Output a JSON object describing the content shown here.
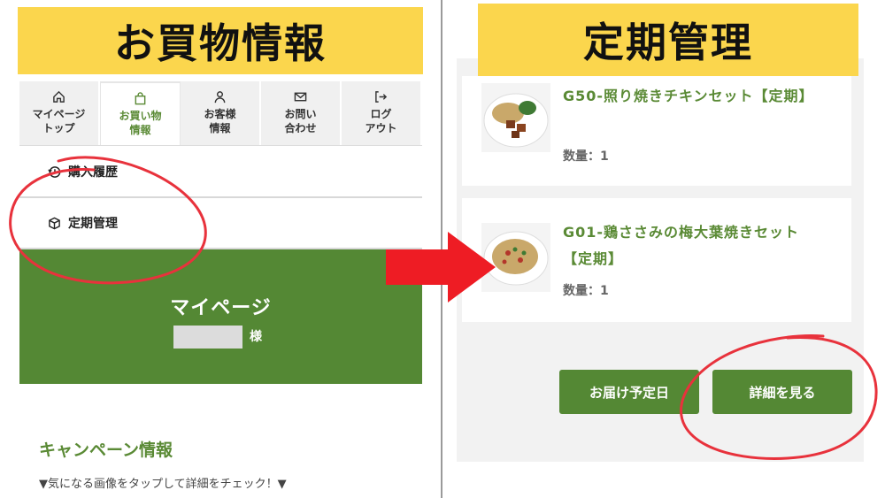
{
  "banners": {
    "left": "お買物情報",
    "right": "定期管理"
  },
  "nav": {
    "tabs": [
      {
        "label": "マイページ\nトップ",
        "icon": "home-icon"
      },
      {
        "label": "お買い物\n情報",
        "icon": "shopping-bag-icon",
        "active": true
      },
      {
        "label": "お客様\n情報",
        "icon": "user-icon"
      },
      {
        "label": "お問い\n合わせ",
        "icon": "mail-icon"
      },
      {
        "label": "ログ\nアウト",
        "icon": "logout-icon"
      }
    ]
  },
  "submenu": {
    "history": "購入履歴",
    "subscription": "定期管理"
  },
  "mypage": {
    "title": "マイページ",
    "honorific": "様"
  },
  "campaign": {
    "title": "キャンペーン情報",
    "subtitle": "▼気になる画像をタップして詳細をチェック！▼"
  },
  "subscription_items": [
    {
      "name": "G50-照り焼きチキンセット【定期】",
      "quantity": "数量：1"
    },
    {
      "name": "G01-鶏ささみの梅大葉焼きセット【定期】",
      "quantity": "数量：1"
    }
  ],
  "buttons": {
    "delivery": "お届け予定日",
    "detail": "詳細を見る"
  },
  "colors": {
    "brand_green": "#548834",
    "banner_yellow": "#fbd64d",
    "annotation_red": "#e8323c"
  }
}
